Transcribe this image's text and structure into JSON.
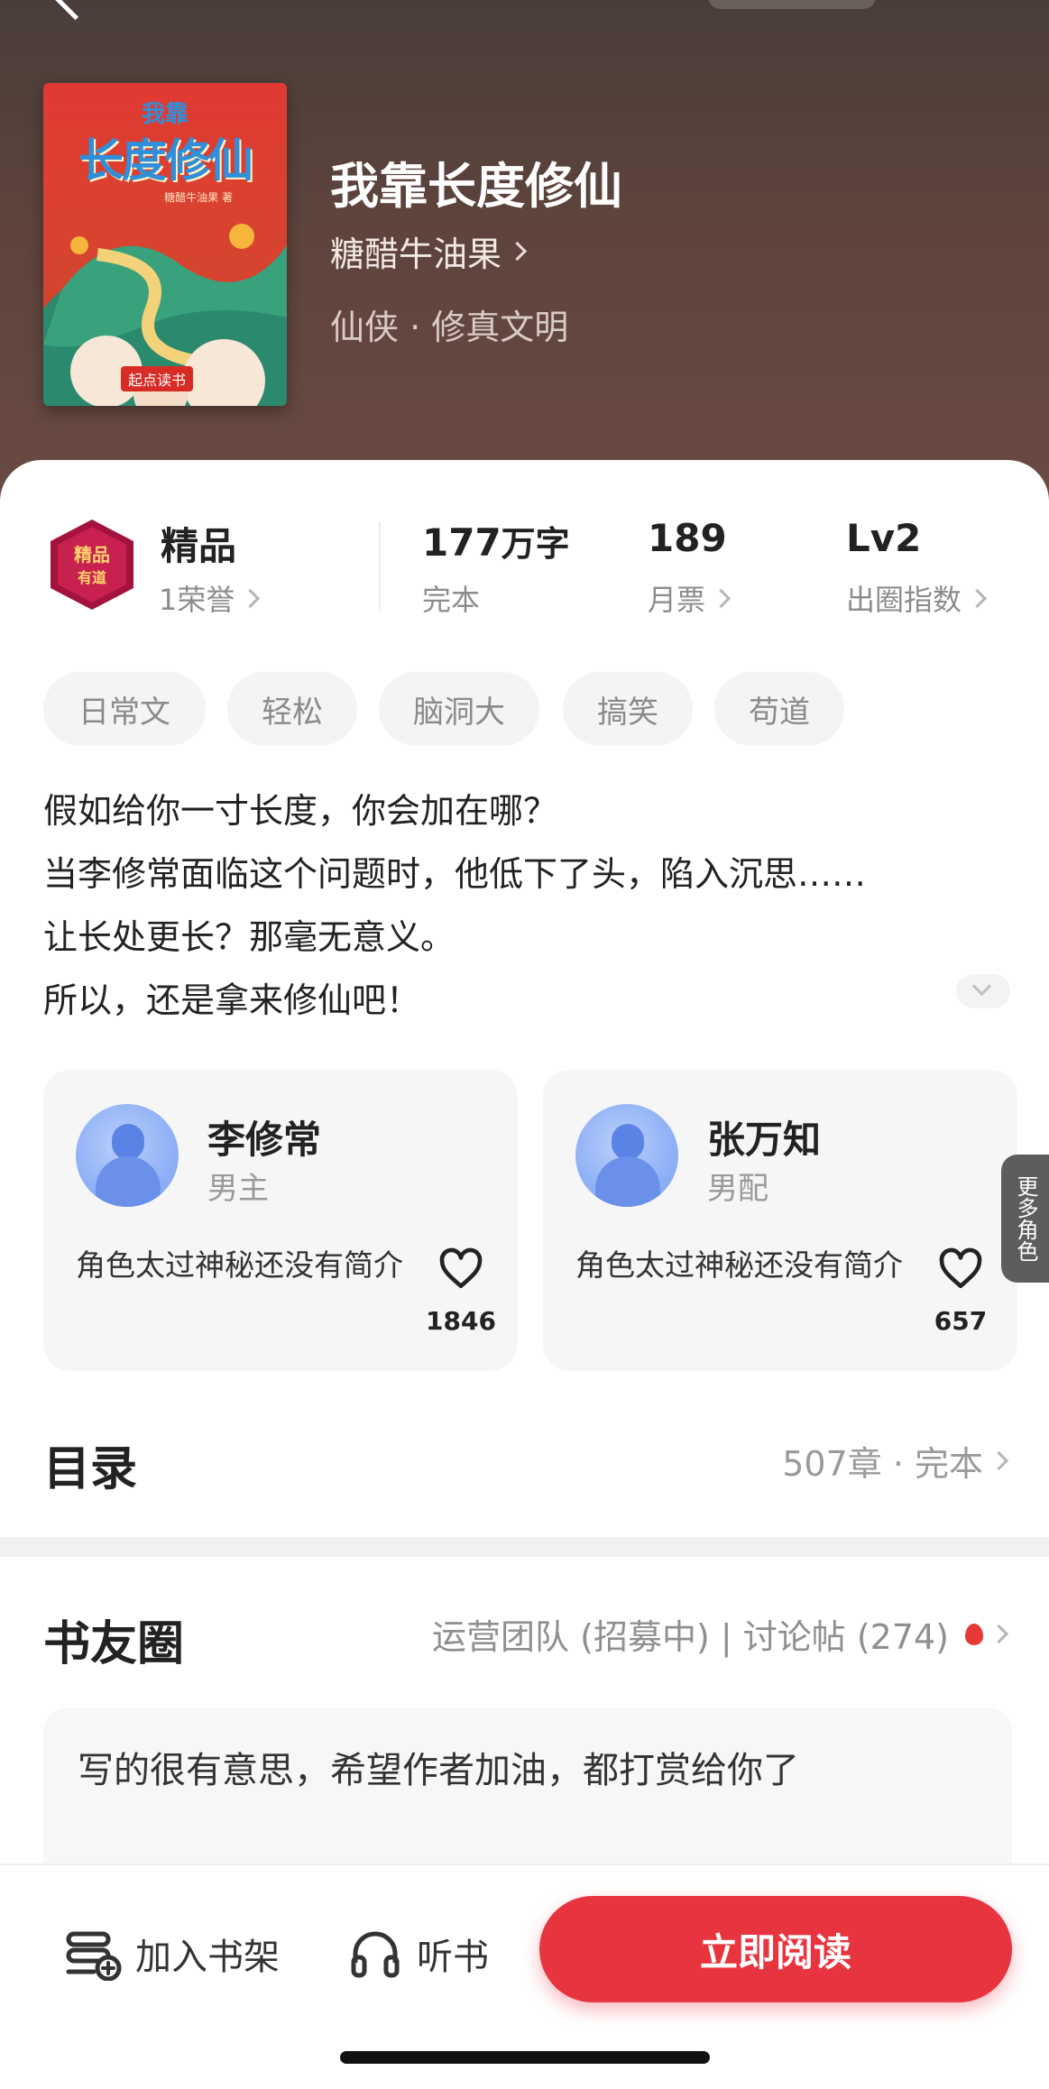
{
  "book": {
    "title": "我靠长度修仙",
    "author": "糖醋牛油果",
    "genre": "仙侠 · 修真文明",
    "cover": {
      "title_small": "我靠",
      "title_large": "长度修仙",
      "author_tag": "糖醋牛油果 著",
      "publisher": "起点读书"
    }
  },
  "stats": {
    "badge": {
      "icon": "premium-badge-icon",
      "title": "精品",
      "sub": "1荣誉"
    },
    "words": {
      "value": "177",
      "unit": "万字",
      "sub": "完本"
    },
    "tickets": {
      "value": "189",
      "sub": "月票"
    },
    "level": {
      "value": "Lv2",
      "sub": "出圈指数"
    }
  },
  "tags": [
    "日常文",
    "轻松",
    "脑洞大",
    "搞笑",
    "苟道"
  ],
  "description": [
    "假如给你一寸长度，你会加在哪？",
    "当李修常面临这个问题时，他低下了头，陷入沉思……",
    "让长处更长？那毫无意义。",
    "所以，还是拿来修仙吧！"
  ],
  "characters": [
    {
      "name": "李修常",
      "role": "男主",
      "desc": "角色太过神秘还没有简介",
      "likes": "1846"
    },
    {
      "name": "张万知",
      "role": "男配",
      "desc": "角色太过神秘还没有简介",
      "likes": "657"
    }
  ],
  "more_characters": "更多角色",
  "toc": {
    "title": "目录",
    "meta": "507章 · 完本"
  },
  "circle": {
    "title": "书友圈",
    "meta": "运营团队 (招募中) | 讨论帖 (274)"
  },
  "post": {
    "text": "写的很有意思，希望作者加油，都打赏给你了"
  },
  "bottom": {
    "add_shelf": "加入书架",
    "listen": "听书",
    "read": "立即阅读"
  },
  "colors": {
    "accent": "#e8343f",
    "hero_bg": "#5e443d",
    "avatar": "#8fb1f6"
  }
}
